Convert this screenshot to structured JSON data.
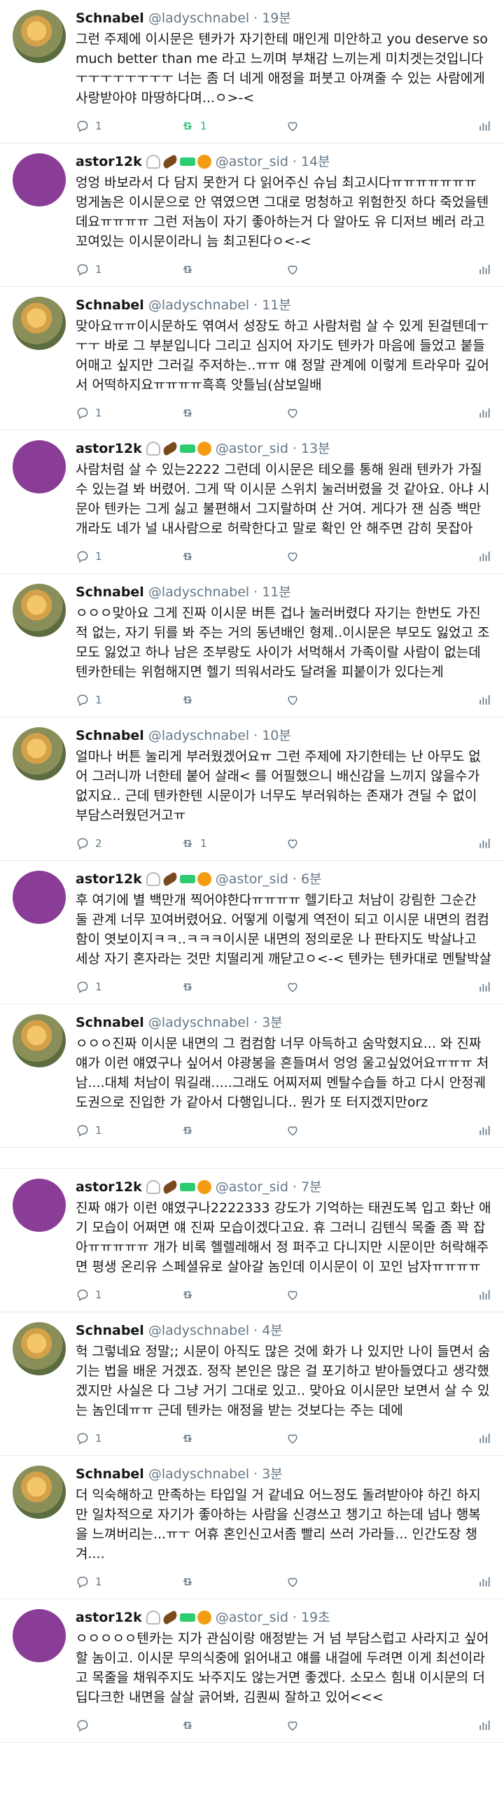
{
  "tweets": [
    {
      "avatar": "schnabel",
      "name": "Schnabel",
      "handle": "@ladyschnabel",
      "sep": "·",
      "time": "19분",
      "emojis": [],
      "text": "그런 주제에 이시문은 텐카가 자기한테 매인게 미안하고 you deserve so much better than me 라고 느끼며 부채감 느끼는게 미치겟는것입니다ㅜㅜㅜㅜㅜㅜㅜㅜ 너는 좀 더 네게 애정을 퍼붓고 아껴줄 수 있는 사람에게 사랑받아야 마땅하다며...ㅇ>-<",
      "reply": "1",
      "retweet": "1",
      "like": "",
      "retweet_on": true
    },
    {
      "avatar": "astor",
      "name": "astor12k",
      "handle": "@astor_sid",
      "sep": "·",
      "time": "14분",
      "emojis": [
        "ghost",
        "bean",
        "gun",
        "pumpkin"
      ],
      "text": "엉엉 바보라서 다 담지 못한거 다 읽어주신 슈님 최고시다ㅠㅠㅠㅠㅠㅠㅠ 멍게놈은 이시문으로 안 엮였으면 그대로 멍청하고 위험한짓 하다 죽었을텐데요ㅠㅠㅠㅠ 그런 저놈이 자기 좋아하는거 다 알아도 유 디저브 베러 라고 꼬여있는 이시문이라니 늠 최고된다ㅇ<-<",
      "reply": "1",
      "retweet": "",
      "like": "",
      "retweet_on": false
    },
    {
      "avatar": "schnabel",
      "name": "Schnabel",
      "handle": "@ladyschnabel",
      "sep": "·",
      "time": "11분",
      "emojis": [],
      "text": "맞아요ㅠㅠ이시문하도 엮여서 성장도 하고 사람처럼 살 수 있게 된걸텐데ㅜㅜㅜ 바로 그 부분입니다 그리고 심지어 자기도 텐카가 마음에 들었고 붙들어매고 싶지만 그러길 주저하는..ㅠㅠ 얘 정말 관계에 이렇게 트라우마 깊어서 어떡하지요ㅠㅠㅠㅠ흑흑 앗틀님(삼보일배",
      "reply": "1",
      "retweet": "",
      "like": "",
      "retweet_on": false
    },
    {
      "avatar": "astor",
      "name": "astor12k",
      "handle": "@astor_sid",
      "sep": "·",
      "time": "13분",
      "emojis": [
        "ghost",
        "bean",
        "gun",
        "pumpkin"
      ],
      "text": "사람처럼 살 수 있는2222 그런데 이시문은 테오를 통해 원래 텐카가 가질 수 있는걸 봐 버렸어. 그게 딱 이시문 스위치 눌러버렸을 것 같아요. 아냐 시문아 텐카는 그게 싫고 불편해서 그지랄하며 산 거여. 게다가 잰 심증 백만개라도 네가 널 내사람으로 허락한다고 말로 확인 안 해주면 감히 못잡아",
      "reply": "1",
      "retweet": "",
      "like": "",
      "retweet_on": false
    },
    {
      "avatar": "schnabel",
      "name": "Schnabel",
      "handle": "@ladyschnabel",
      "sep": "·",
      "time": "11분",
      "emojis": [],
      "text": "ㅇㅇㅇ맞아요 그게 진짜 이시문 버튼 겁나 눌러버렸다 자기는 한번도 가진 적 없는, 자기 뒤를 봐 주는 거의 동년배인 형제..이시문은 부모도 잃었고 조모도 잃었고 하나 남은 조부랑도 사이가 서먹해서 가족이랄 사람이 없는데 텐카한테는 위험해지면 헬기 띄워서라도 달려올 피붙이가 있다는게",
      "reply": "1",
      "retweet": "",
      "like": "",
      "retweet_on": false
    },
    {
      "avatar": "schnabel",
      "name": "Schnabel",
      "handle": "@ladyschnabel",
      "sep": "·",
      "time": "10분",
      "emojis": [],
      "text": "얼마나 버튼 눌리게 부러웠겠어요ㅠ 그런 주제에 자기한테는 난 아무도 없어 그러니까 너한테 붙어 살래< 를 어필했으니 배신감을 느끼지 않을수가 없지요.. 근데 텐카한텐 시문이가 너무도 부러워하는 존재가 견딜 수 없이 부담스러웠던거고ㅠ",
      "reply": "2",
      "retweet": "1",
      "like": "",
      "retweet_on": false
    },
    {
      "avatar": "astor",
      "name": "astor12k",
      "handle": "@astor_sid",
      "sep": "·",
      "time": "6분",
      "emojis": [
        "ghost",
        "bean",
        "gun",
        "pumpkin"
      ],
      "text": "후 여기에 별 백만개 찍어야한다ㅠㅠㅠㅠ 헬기타고 처남이 강림한 그순간 둘 관계 너무 꼬여버렸어요. 어떻게 이렇게 역전이 되고 이시문 내면의 컴컴함이 엿보이지ㅋㅋ..ㅋㅋㅋ이시문 내면의 정의로운 나 판타지도 박살나고 세상 자기 혼자라는 것만 치떨리게 깨닫고ㅇ<-< 텐카는 텐카대로 멘탈박살",
      "reply": "1",
      "retweet": "",
      "like": "",
      "retweet_on": false
    },
    {
      "avatar": "schnabel",
      "name": "Schnabel",
      "handle": "@ladyschnabel",
      "sep": "·",
      "time": "3분",
      "emojis": [],
      "text": "ㅇㅇㅇ진짜 이시문 내면의 그 컴컴함 너무 아득하고 숨막혔지요... 와 진짜 얘가 이런 얘였구나 싶어서 야광봉을 흔들며서 엉엉 울고싶었어요ㅠㅠㅠ 처남....대체 처남이 뭐길래.....그래도 어찌저찌 멘탈수습들 하고 다시 안정궤도권으로 진입한 가 같아서 다행입니다.. 뭔가 또 터지겠지만orz",
      "reply": "1",
      "retweet": "",
      "like": "",
      "retweet_on": false,
      "gap_after": true
    },
    {
      "avatar": "astor",
      "name": "astor12k",
      "handle": "@astor_sid",
      "sep": "·",
      "time": "7분",
      "emojis": [
        "ghost",
        "bean",
        "gun",
        "pumpkin"
      ],
      "text": "진짜 얘가 이런 얘였구나2222333 강도가 기억하는 태권도복 입고 화난 애기 모습이 어쩌면 얘 진짜 모습이겠다고요. 휴 그러니 김텐식 목줄 좀 꽉 잡아ㅠㅠㅠㅠㅠ 개가 비록 헬렐레해서 정 퍼주고 다니지만 시문이만 허락해주면 평생 온리유 스페셜유로 살아갈 놈인데 이시문이 이 꼬인 남자ㅠㅠㅠㅠ",
      "reply": "1",
      "retweet": "",
      "like": "",
      "retweet_on": false
    },
    {
      "avatar": "schnabel",
      "name": "Schnabel",
      "handle": "@ladyschnabel",
      "sep": "·",
      "time": "4분",
      "emojis": [],
      "text": "헉 그렇네요 정말;; 시문이 아직도 많은 것에 화가 나 있지만 나이 들면서 숨기는 법을 배운 거겠죠. 정작 본인은 많은 걸 포기하고 받아들였다고 생각했겠지만 사실은 다 그냥 거기 그대로 있고.. 맞아요 이시문만 보면서 살 수 있는 놈인데ㅠㅠ 근데 텐카는 애정을 받는 것보다는 주는 데에",
      "reply": "1",
      "retweet": "",
      "like": "",
      "retweet_on": false
    },
    {
      "avatar": "schnabel",
      "name": "Schnabel",
      "handle": "@ladyschnabel",
      "sep": "·",
      "time": "3분",
      "emojis": [],
      "text": "더 익숙해하고 만족하는 타입일 거 같네요 어느정도 돌려받아야 하긴 하지만 일차적으로 자기가 좋아하는 사람을 신경쓰고 챙기고 하는데 넘나 행복을 느껴버리는...ㅠㅜ 어휴 혼인신고서좀 빨리 쓰러 가라들... 인간도장 챙겨....",
      "reply": "1",
      "retweet": "",
      "like": "",
      "retweet_on": false
    },
    {
      "avatar": "astor",
      "name": "astor12k",
      "handle": "@astor_sid",
      "sep": "·",
      "time": "19초",
      "emojis": [
        "ghost",
        "bean",
        "gun",
        "pumpkin"
      ],
      "text": "ㅇㅇㅇㅇㅇ텐카는 지가 관심이랑 애정받는 거 넘 부담스럽고 사라지고 싶어할 놈이고. 이시문 무의식중에 읽어내고 얘를 내걸에 두려면 이게 최선이라고 목줄을 채워주지도 놔주지도 않는거면 좋겠다. 소모스 힘내 이시문의 더 딥다크한 내면을 살살 긁어봐, 김퀀씨 잘하고 있어<<<",
      "reply": "",
      "retweet": "",
      "like": "",
      "retweet_on": false
    }
  ]
}
